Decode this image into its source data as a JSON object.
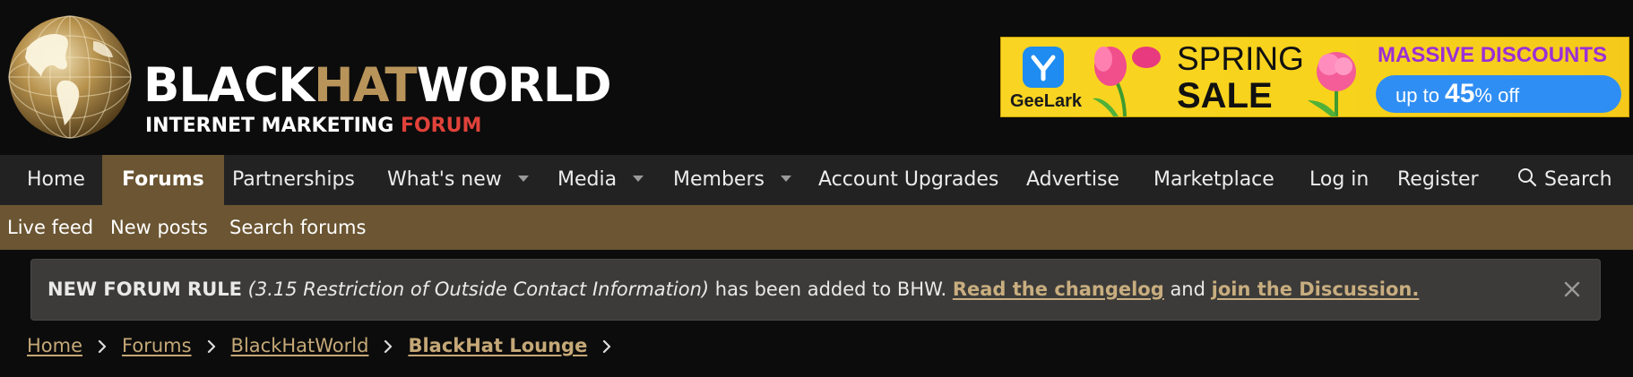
{
  "logo": {
    "line1_part1": "BLACK",
    "line1_part2": "HAT",
    "line1_part3": "WORLD",
    "line2_part1": "INTERNET MARKETING ",
    "line2_part2": "FORUM",
    "icon": "globe-icon"
  },
  "ad": {
    "brand": "GeeLark",
    "headline_1": "SPRING",
    "headline_2": "SALE",
    "promo_title": "MASSIVE DISCOUNTS",
    "promo_prefix": "up to ",
    "promo_percent": "45",
    "promo_suffix": "% off",
    "colors": {
      "background": "#f9d423",
      "pill": "#2f8ef4",
      "title": "#9b2fd6"
    }
  },
  "nav": {
    "items": [
      {
        "label": "Home",
        "active": false,
        "has_dropdown": false
      },
      {
        "label": "Forums",
        "active": true,
        "has_dropdown": false
      },
      {
        "label": "Partnerships",
        "active": false,
        "has_dropdown": false
      },
      {
        "label": "What's new",
        "active": false,
        "has_dropdown": true
      },
      {
        "label": "Media",
        "active": false,
        "has_dropdown": true
      },
      {
        "label": "Members",
        "active": false,
        "has_dropdown": true
      },
      {
        "label": "Account Upgrades",
        "active": false,
        "has_dropdown": false
      },
      {
        "label": "Advertise",
        "active": false,
        "has_dropdown": false
      },
      {
        "label": "Marketplace",
        "active": false,
        "has_dropdown": false
      }
    ],
    "login": "Log in",
    "register": "Register",
    "search": "Search",
    "colors": {
      "bar": "#222222",
      "active": "#6b5532"
    }
  },
  "subnav": {
    "items": [
      "Live feed",
      "New posts",
      "Search forums"
    ],
    "color": "#6b5532"
  },
  "notice": {
    "title": "NEW FORUM RULE",
    "rule": "(3.15 Restriction of Outside Contact Information)",
    "middle": " has been added to BHW. ",
    "link1": "Read the changelog",
    "and": " and ",
    "link2": "join the Discussion.",
    "close_icon": "close-icon"
  },
  "breadcrumb": {
    "items": [
      "Home",
      "Forums",
      "BlackHatWorld",
      "BlackHat Lounge"
    ],
    "link_color": "#c5a877"
  }
}
